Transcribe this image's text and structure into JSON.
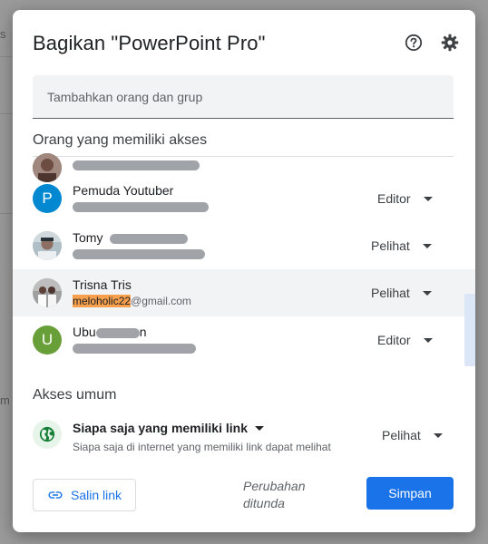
{
  "background": {
    "left_letter_1": "s",
    "left_letter_2": "m"
  },
  "dialog": {
    "title": "Bagikan \"PowerPoint Pro\"",
    "help_icon": "help-circle-icon",
    "settings_icon": "gear-icon"
  },
  "add_people": {
    "placeholder": "Tambahkan orang dan grup"
  },
  "people_section": {
    "title": "Orang yang memiliki akses",
    "people": [
      {
        "name": "",
        "email": "",
        "role": "",
        "avatar_type": "photo"
      },
      {
        "name": "Pemuda Youtuber",
        "email": "",
        "role": "Editor",
        "avatar_letter": "P",
        "avatar_color": "#0288d1"
      },
      {
        "name": "Tomy",
        "email": "",
        "role": "Pelihat",
        "avatar_type": "photo"
      },
      {
        "name": "Trisna Tris",
        "email_highlight": "meloholic22",
        "email_rest": "@gmail.com",
        "role": "Pelihat",
        "avatar_type": "photo"
      },
      {
        "name": "Ubu",
        "name_suffix": "n",
        "email": "",
        "role": "Editor",
        "avatar_letter": "U",
        "avatar_color": "#689f38"
      }
    ]
  },
  "general_access": {
    "title": "Akses umum",
    "option": "Siapa saja yang memiliki link",
    "description": "Siapa saja di internet yang memiliki link dapat melihat",
    "role": "Pelihat",
    "icon": "globe-icon"
  },
  "footer": {
    "copy_link": "Salin link",
    "copy_icon": "link-icon",
    "pending_line1": "Perubahan",
    "pending_line2": "ditunda",
    "save": "Simpan"
  },
  "colors": {
    "accent": "#1a73e8",
    "highlight_row": "#f1f3f4",
    "email_highlight": "#f6a04d",
    "globe_bg": "#e6f4ea",
    "globe": "#188038"
  }
}
